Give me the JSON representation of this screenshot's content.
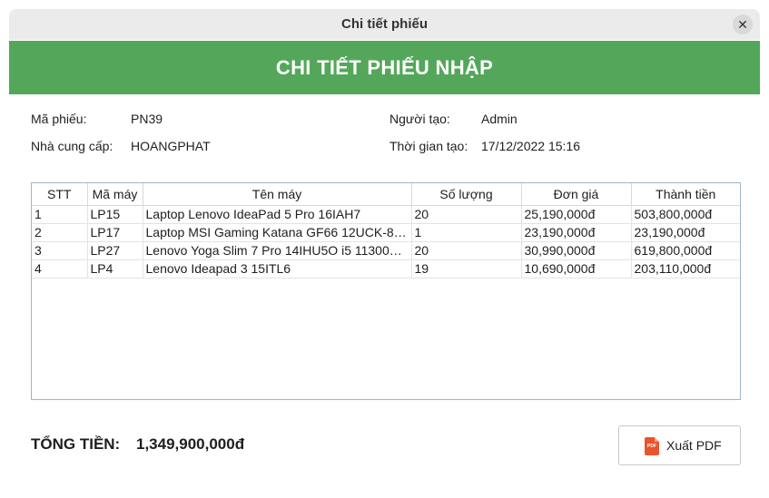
{
  "window": {
    "title": "Chi tiết phiếu",
    "close_symbol": "✕"
  },
  "banner": {
    "title": "CHI TIẾT PHIẾU NHẬP"
  },
  "info": {
    "code_label": "Mã phiếu:",
    "code_value": "PN39",
    "supplier_label": "Nhà cung cấp:",
    "supplier_value": "HOANGPHAT",
    "creator_label": "Người tạo:",
    "creator_value": "Admin",
    "time_label": "Thời gian tạo:",
    "time_value": "17/12/2022 15:16"
  },
  "table": {
    "headers": [
      "STT",
      "Mã máy",
      "Tên máy",
      "Số lượng",
      "Đơn giá",
      "Thành tiền"
    ],
    "rows": [
      [
        "1",
        "LP15",
        "Laptop Lenovo IdeaPad 5 Pro 16IAH7",
        "20",
        "25,190,000đ",
        "503,800,000đ"
      ],
      [
        "2",
        "LP17",
        "Laptop MSI Gaming Katana GF66 12UCK-81...",
        "1",
        "23,190,000đ",
        "23,190,000đ"
      ],
      [
        "3",
        "LP27",
        "Lenovo Yoga Slim 7 Pro 14IHU5O i5 11300H...",
        "20",
        "30,990,000đ",
        "619,800,000đ"
      ],
      [
        "4",
        "LP4",
        "Lenovo Ideapad 3 15ITL6",
        "19",
        "10,690,000đ",
        "203,110,000đ"
      ]
    ]
  },
  "total": {
    "label": "TỔNG TIỀN:",
    "value": "1,349,900,000đ"
  },
  "export_button": {
    "label": "Xuất PDF",
    "icon_text": "PDF",
    "icon": "pdf-file-icon"
  },
  "colors": {
    "banner": "#54a75a",
    "pdf_icon": "#e8542c",
    "table_border": "#9fb4c8"
  }
}
